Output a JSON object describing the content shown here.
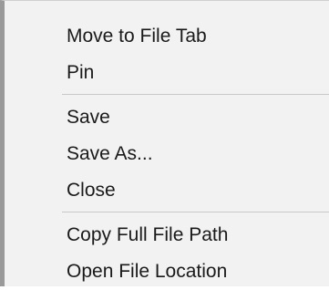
{
  "menu": {
    "group_file_tab": [
      {
        "label": "Move to File Tab"
      },
      {
        "label": "Pin"
      }
    ],
    "group_save": [
      {
        "label": "Save"
      },
      {
        "label": "Save As..."
      },
      {
        "label": "Close"
      }
    ],
    "group_path": [
      {
        "label": "Copy Full File Path"
      },
      {
        "label": "Open File Location"
      }
    ]
  },
  "colors": {
    "menu_background": "#f2f2f2",
    "separator": "#c8c8c8",
    "text": "#1a1a1a"
  }
}
